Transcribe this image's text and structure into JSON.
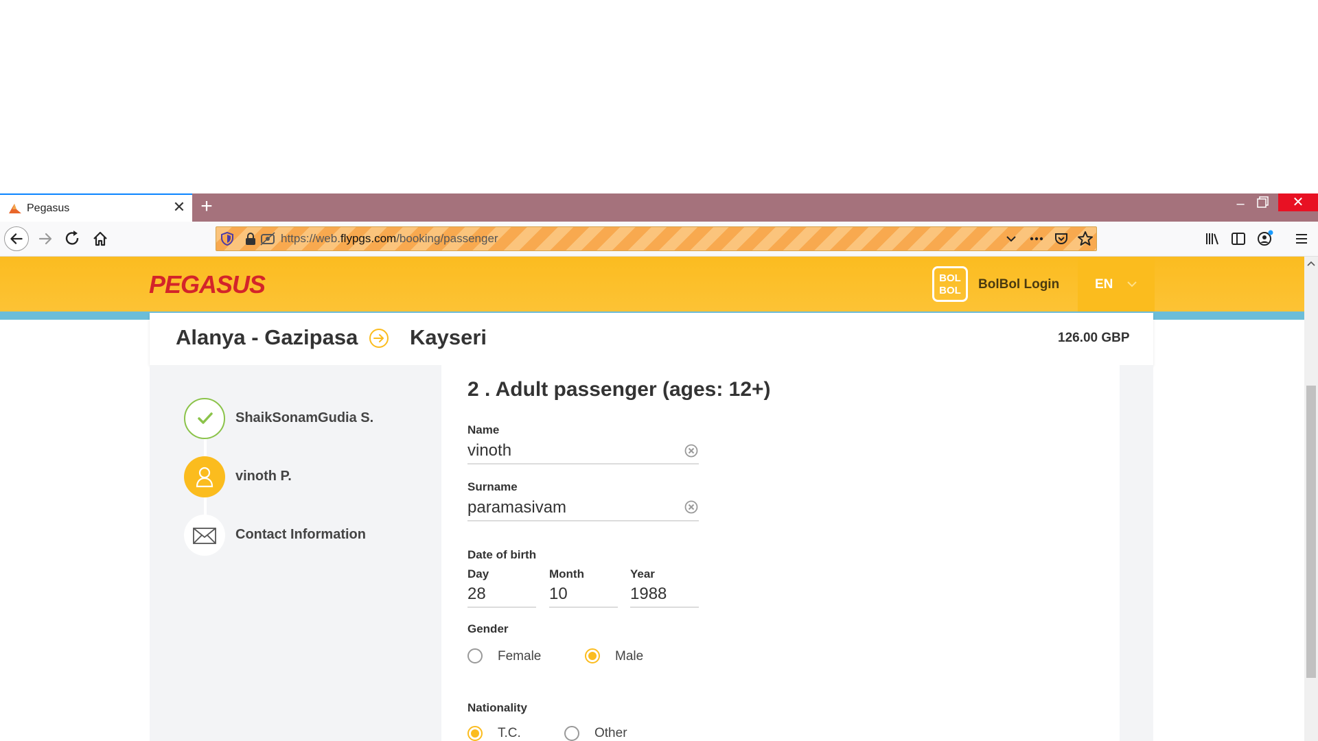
{
  "browser": {
    "tab_title": "Pegasus",
    "tab_close": "✕",
    "new_tab": "+",
    "window_min": "–",
    "window_close": "✕",
    "url_prefix": "https://web.",
    "url_domain": "flypgs.com",
    "url_path": "/booking/passenger"
  },
  "header": {
    "logo": "PEGASUS",
    "bolbol_badge_line1": "BOL",
    "bolbol_badge_line2": "BOL",
    "bolbol_login": "BolBol Login",
    "language": "EN",
    "brand_color": "#fdc02a",
    "logo_color": "#d3242a"
  },
  "route": {
    "from": "Alanya - Gazipasa",
    "to": "Kayseri",
    "price": "126.00 GBP"
  },
  "steps": [
    {
      "label": "ShaikSonamGudia S.",
      "status": "done",
      "icon": "check-icon"
    },
    {
      "label": "vinoth P.",
      "status": "active",
      "icon": "person-icon"
    },
    {
      "label": "Contact Information",
      "status": "pending",
      "icon": "envelope-icon"
    }
  ],
  "form": {
    "title": "2 . Adult passenger (ages: 12+)",
    "name_label": "Name",
    "name_value": "vinoth",
    "surname_label": "Surname",
    "surname_value": "paramasivam",
    "dob_label": "Date of birth",
    "day_label": "Day",
    "day_value": "28",
    "month_label": "Month",
    "month_value": "10",
    "year_label": "Year",
    "year_value": "1988",
    "gender_label": "Gender",
    "gender_options": [
      "Female",
      "Male"
    ],
    "gender_selected": "Male",
    "nationality_label": "Nationality",
    "nationality_options": [
      "T.C.",
      "Other"
    ],
    "nationality_selected": "T.C."
  }
}
